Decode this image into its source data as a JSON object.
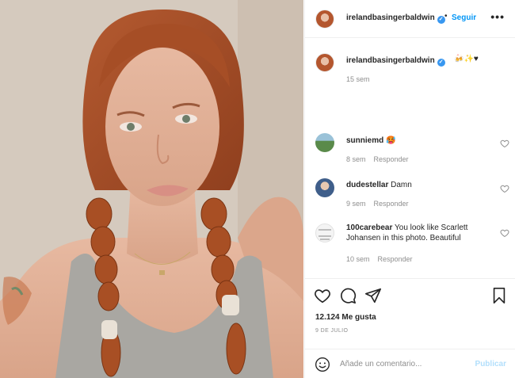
{
  "post": {
    "image_alt": "Selfie of a woman with red braided hair",
    "author": {
      "username": "irelandbasingerbaldwin",
      "verified_icon": "verified-badge-icon",
      "verified_glyph": "✓"
    },
    "header": {
      "separator": "•",
      "follow_label": "Seguir",
      "more_label": "•••"
    },
    "caption": {
      "username": "irelandbasingerbaldwin",
      "text": "🍻✨♥",
      "time": "15 sem"
    },
    "comments": [
      {
        "username": "sunniemd",
        "text": "🥵",
        "time": "8 sem",
        "reply_label": "Responder"
      },
      {
        "username": "dudestellar",
        "text": "Damn",
        "time": "9 sem",
        "reply_label": "Responder"
      },
      {
        "username": "100carebear",
        "text": "You look like Scarlett Johansen in this photo. Beautiful",
        "time": "10 sem",
        "reply_label": "Responder"
      }
    ],
    "actions": {
      "like_icon": "heart-icon",
      "comment_icon": "comment-icon",
      "share_icon": "paper-plane-icon",
      "save_icon": "bookmark-icon"
    },
    "likes": "12.124 Me gusta",
    "date": "9 DE JULIO",
    "add_comment": {
      "placeholder": "Añade un comentario...",
      "publish_label": "Publicar"
    }
  },
  "colors": {
    "accent": "#0095f6",
    "verified": "#3897f0",
    "publish_disabled": "#b2dffc",
    "muted": "#8e8e8e",
    "text": "#262626",
    "border": "#efefef"
  }
}
